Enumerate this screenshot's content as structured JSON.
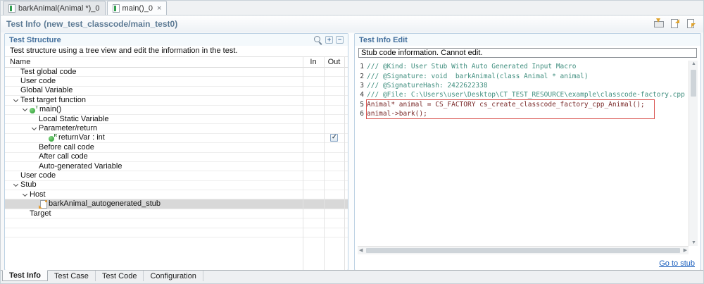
{
  "colors": {
    "accent_blue": "#44709d",
    "panel_border": "#bdd2e4",
    "comment_green": "#3f8e7e",
    "code_dark_red": "#7a2a2a",
    "highlight_red": "#d9534f",
    "selection_gray": "#d8d8d8",
    "link_blue": "#1b5fbd"
  },
  "editor_tabs": [
    {
      "label": "barkAnimal(Animal *)_0",
      "icon": "test-file-icon",
      "active": false,
      "closable": false
    },
    {
      "label": "main()_0",
      "icon": "test-file-icon",
      "active": true,
      "closable": true,
      "close_glyph": "×"
    }
  ],
  "title_bar": {
    "title": "Test Info",
    "subtitle": "(new_test_classcode/main_test0)",
    "icons": [
      "save-icon",
      "export-icon",
      "import-icon"
    ]
  },
  "left_panel": {
    "title": "Test Structure",
    "header_icons": [
      "search-icon",
      "expand-all-icon",
      "collapse-all-icon"
    ],
    "description": "Test structure using a tree view and edit the information in the test.",
    "columns": {
      "name": "Name",
      "in": "In",
      "out": "Out"
    },
    "tree": [
      {
        "label": "Test global code",
        "indent": 8,
        "chevron": false,
        "icon": null
      },
      {
        "label": "User code",
        "indent": 8,
        "chevron": false,
        "icon": null
      },
      {
        "label": "Global Variable",
        "indent": 8,
        "chevron": false,
        "icon": null
      },
      {
        "label": "Test target function",
        "indent": 8,
        "chevron": true,
        "icon": null
      },
      {
        "label": "main()",
        "indent": 21,
        "chevron": true,
        "icon": "method-icon",
        "badge": "T"
      },
      {
        "label": "Local Static Variable",
        "indent": 34,
        "chevron": false,
        "icon": null
      },
      {
        "label": "Parameter/return",
        "indent": 34,
        "chevron": true,
        "icon": null
      },
      {
        "label": "returnVar : int",
        "indent": 48,
        "chevron": false,
        "icon": "parameter-icon",
        "badge": "R",
        "out_checked": true
      },
      {
        "label": "Before call code",
        "indent": 34,
        "chevron": false,
        "icon": null
      },
      {
        "label": "After call code",
        "indent": 34,
        "chevron": false,
        "icon": null
      },
      {
        "label": "Auto-generated Variable",
        "indent": 34,
        "chevron": false,
        "icon": null
      },
      {
        "label": "User code",
        "indent": 8,
        "chevron": false,
        "icon": null
      },
      {
        "label": "Stub",
        "indent": 8,
        "chevron": true,
        "icon": null
      },
      {
        "label": "Host",
        "indent": 21,
        "chevron": true,
        "icon": null
      },
      {
        "label": "barkAnimal_autogenerated_stub",
        "indent": 34,
        "chevron": false,
        "icon": "stub-icon",
        "selected": true
      },
      {
        "label": "Target",
        "indent": 21,
        "chevron": false,
        "icon": null
      },
      {
        "label": "",
        "indent": 8,
        "empty": true
      },
      {
        "label": "",
        "indent": 8,
        "empty": true
      }
    ]
  },
  "right_panel": {
    "title": "Test Info Edit",
    "info_box": "Stub code information. Cannot edit.",
    "code_lines": [
      {
        "num": "1",
        "text": "/// @Kind: User Stub With Auto Generated Input Macro",
        "type": "comment"
      },
      {
        "num": "2",
        "text": "/// @Signature: void  barkAnimal(class Animal * animal)",
        "type": "comment"
      },
      {
        "num": "3",
        "text": "/// @SignatureHash: 2422622338",
        "type": "comment"
      },
      {
        "num": "4",
        "text": "/// @File: C:\\Users\\user\\Desktop\\CT_TEST_RESOURCE\\example\\classcode-factory.cpp",
        "type": "comment"
      },
      {
        "num": "5",
        "text": "Animal* animal = CS_FACTORY cs_create_classcode_factory_cpp_Animal();",
        "type": "code",
        "highlight": true
      },
      {
        "num": "6",
        "text": "animal->bark();",
        "type": "code",
        "highlight": true
      }
    ],
    "goto_link": "Go to stub"
  },
  "bottom_tabs": [
    {
      "label": "Test Info",
      "active": true
    },
    {
      "label": "Test Case",
      "active": false
    },
    {
      "label": "Test Code",
      "active": false
    },
    {
      "label": "Configuration",
      "active": false
    }
  ]
}
